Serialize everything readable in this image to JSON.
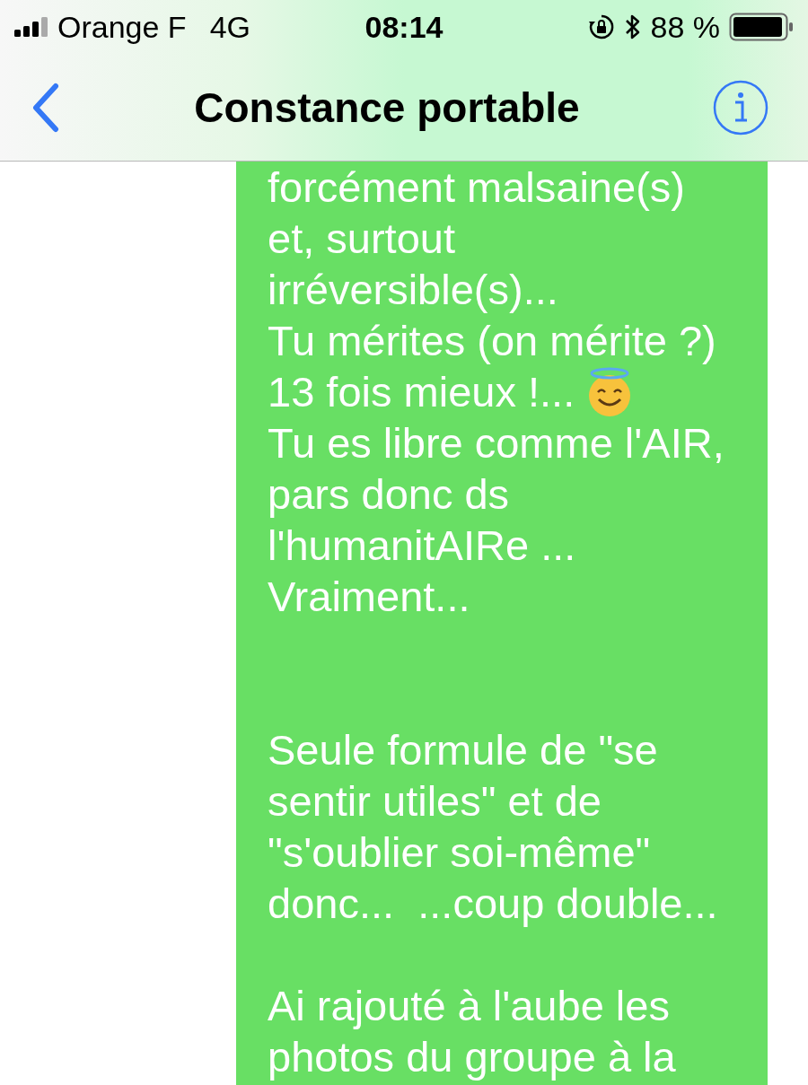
{
  "status_bar": {
    "carrier": "Orange F",
    "network": "4G",
    "time": "08:14",
    "battery_percent": "88 %"
  },
  "nav_bar": {
    "title": "Constance portable"
  },
  "message": {
    "lines": [
      {
        "kind": "text",
        "text": "forcément malsaine(s)",
        "emoji": false
      },
      {
        "kind": "text",
        "text": "et, surtout",
        "emoji": false
      },
      {
        "kind": "text",
        "text": "irréversible(s)...",
        "emoji": false
      },
      {
        "kind": "text",
        "text": "Tu mérites (on mérite ?)",
        "emoji": false
      },
      {
        "kind": "text",
        "text": "13 fois mieux !...",
        "emoji": true
      },
      {
        "kind": "text",
        "text": "Tu es libre comme l'AIR,",
        "emoji": false
      },
      {
        "kind": "text",
        "text": "pars donc ds",
        "emoji": false
      },
      {
        "kind": "text",
        "text": "l'humanitAIRe ...",
        "emoji": false
      },
      {
        "kind": "text",
        "text": "Vraiment...",
        "emoji": false
      },
      {
        "kind": "blank"
      },
      {
        "kind": "blank"
      },
      {
        "kind": "text",
        "text": "Seule formule de \"se",
        "emoji": false
      },
      {
        "kind": "text",
        "text": "sentir utiles\" et de",
        "emoji": false
      },
      {
        "kind": "text",
        "text": "\"s'oublier soi-même\"",
        "emoji": false
      },
      {
        "kind": "text",
        "text": "donc...  ...coup double...",
        "emoji": false
      },
      {
        "kind": "blank"
      },
      {
        "kind": "text",
        "text": "Ai rajouté à l'aube les",
        "emoji": false
      },
      {
        "kind": "text",
        "text": "photos du groupe à la",
        "emoji": false
      }
    ]
  }
}
